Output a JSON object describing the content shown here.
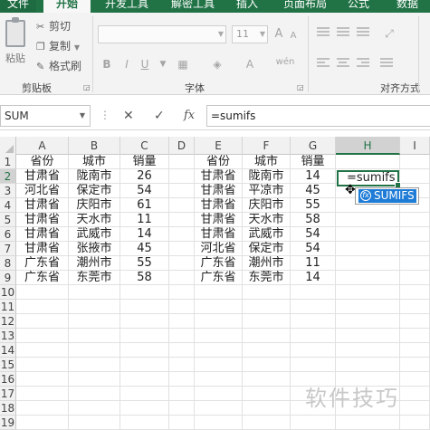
{
  "ribbon": {
    "tabs": [
      "文件",
      "开始",
      "开发工具",
      "解密工具",
      "插入",
      "页面布局",
      "公式",
      "数据"
    ],
    "clipboard": {
      "paste": "粘贴",
      "cut": "剪切",
      "copy": "复制",
      "format_painter": "格式刷",
      "group_label": "剪贴板"
    },
    "font": {
      "size": "11",
      "bold": "B",
      "italic": "I",
      "underline": "U",
      "group_label": "字体",
      "grow": "A",
      "shrink": "A",
      "phonetic": "wén"
    },
    "alignment": {
      "group_label": "对齐方式"
    }
  },
  "formula_bar": {
    "name_box": "SUM",
    "cancel": "✕",
    "enter": "✓",
    "fx": "fx",
    "content": "=sumifs"
  },
  "grid": {
    "columns": [
      "A",
      "B",
      "C",
      "D",
      "E",
      "F",
      "G",
      "H",
      "I"
    ],
    "selected_column": "H",
    "rows": [
      "1",
      "2",
      "3",
      "4",
      "5",
      "6",
      "7",
      "8",
      "9",
      "10",
      "11",
      "12",
      "13",
      "14",
      "15",
      "16",
      "17",
      "18",
      "19"
    ],
    "selected_row": "2",
    "left_table": {
      "headers": [
        "省份",
        "城市",
        "销量"
      ],
      "rows": [
        [
          "甘肃省",
          "陇南市",
          "26"
        ],
        [
          "河北省",
          "保定市",
          "54"
        ],
        [
          "甘肃省",
          "庆阳市",
          "61"
        ],
        [
          "甘肃省",
          "天水市",
          "11"
        ],
        [
          "甘肃省",
          "武威市",
          "14"
        ],
        [
          "甘肃省",
          "张掖市",
          "45"
        ],
        [
          "广东省",
          "潮州市",
          "55"
        ],
        [
          "广东省",
          "东莞市",
          "58"
        ]
      ]
    },
    "right_table": {
      "headers": [
        "省份",
        "城市",
        "销量"
      ],
      "rows": [
        [
          "甘肃省",
          "陇南市",
          "14"
        ],
        [
          "甘肃省",
          "平凉市",
          "45"
        ],
        [
          "甘肃省",
          "庆阳市",
          "55"
        ],
        [
          "甘肃省",
          "天水市",
          "58"
        ],
        [
          "甘肃省",
          "武威市",
          "54"
        ],
        [
          "河北省",
          "保定市",
          "54"
        ],
        [
          "广东省",
          "潮州市",
          "11"
        ],
        [
          "广东省",
          "东莞市",
          "14"
        ]
      ]
    },
    "active_cell_text": "=sumifs",
    "autocomplete_item": "SUMIFS"
  },
  "watermark": "软件技巧",
  "colors": {
    "accent": "#217346",
    "autocomplete": "#1e7bd6"
  }
}
